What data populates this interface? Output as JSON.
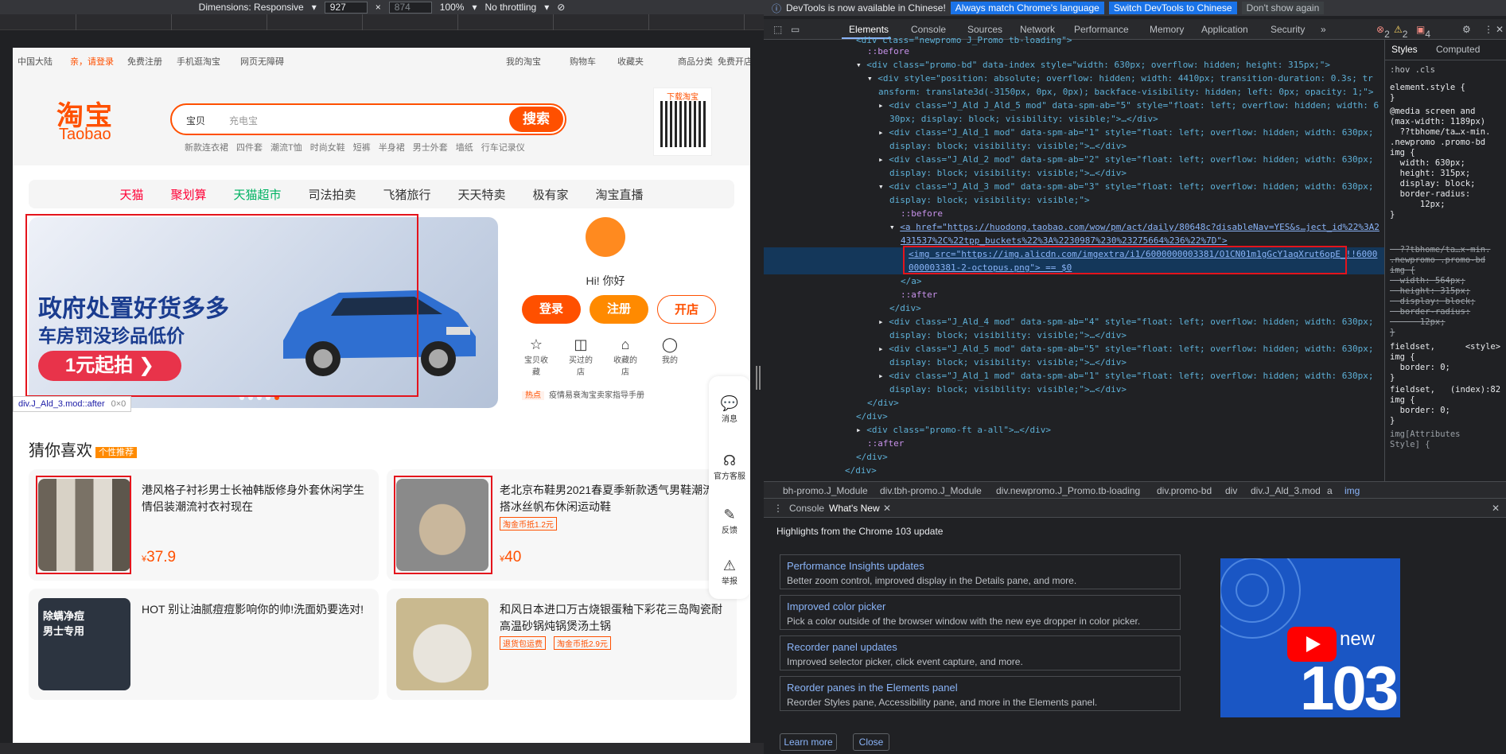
{
  "device_toolbar": {
    "dimensions_label": "Dimensions: Responsive",
    "width": "927",
    "height": "874",
    "zoom": "100%",
    "throttling": "No throttling"
  },
  "taobao": {
    "topbar": [
      "中国大陆",
      "亲，请登录",
      "免费注册",
      "手机逛淘宝",
      "网页无障碍",
      "我的淘宝",
      "购物车",
      "收藏夹",
      "商品分类",
      "免费开店"
    ],
    "logo_cn": "淘宝",
    "logo_en": "Taobao",
    "search_category": "宝贝",
    "search_placeholder": "充电宝",
    "search_button": "搜索",
    "hot_words": [
      "新款连衣裙",
      "四件套",
      "潮流T恤",
      "时尚女鞋",
      "短裤",
      "半身裙",
      "男士外套",
      "墙纸",
      "行车记录仪"
    ],
    "qr_title": "下载淘宝",
    "nav": [
      "天猫",
      "聚划算",
      "天猫超市",
      "司法拍卖",
      "飞猪旅行",
      "天天特卖",
      "极有家",
      "淘宝直播"
    ],
    "banner": {
      "line1": "政府处置好货多多",
      "line2": "车房罚没珍品低价",
      "cta": "1元起拍"
    },
    "inspect_tip": {
      "selector": "div.J_Ald_3.mod::after",
      "size": "0×0"
    },
    "user": {
      "greeting": "Hi! 你好",
      "login": "登录",
      "register": "注册",
      "open_shop": "开店",
      "icons": [
        "宝贝收藏",
        "买过的店",
        "收藏的店",
        "我的"
      ],
      "notice_tag": "热点",
      "notice_text": "疫情易衰淘宝卖家指导手册"
    },
    "float_bar": [
      "消息",
      "官方客服",
      "反馈",
      "举报"
    ],
    "guess_title": "猜你喜欢",
    "guess_badge": "个性推荐",
    "products": [
      {
        "title": "港风格子衬衫男士长袖韩版修身外套休闲学生情侣装潮流衬衣衬现在",
        "tag": "",
        "price": "37.9"
      },
      {
        "title": "老北京布鞋男2021春夏季新款透气男鞋潮流百搭冰丝帆布休闲运动鞋",
        "tag": "淘金币抵1.2元",
        "price": "40"
      },
      {
        "title": "HOT 别让油腻痘痘影响你的帅!洗面奶要选对!",
        "tag": "",
        "price": ""
      },
      {
        "title": "和风日本进口万古烧银蛋釉下彩花三岛陶瓷耐高温砂锅炖锅煲汤土锅",
        "tag": "退货包运费",
        "tag2": "淘金币抵2.9元",
        "price": ""
      }
    ],
    "product_overlay_text": "除螨净痘 男士专用",
    "currency": "¥"
  },
  "devtools": {
    "info_text": "DevTools is now available in Chinese!",
    "info_btn1": "Always match Chrome's language",
    "info_btn2": "Switch DevTools to Chinese",
    "info_btn3": "Don't show again",
    "tabs": [
      "Elements",
      "Console",
      "Sources",
      "Network",
      "Performance",
      "Memory",
      "Application",
      "Security"
    ],
    "issues": {
      "errors": "2",
      "warnings": "2",
      "issues": "4"
    },
    "dom_lines": [
      "<div class=\"newpromo J_Promo tb-loading\">",
      "::before",
      "<div class=\"promo-bd\" data-index style=\"width: 630px; overflow: hidden; height: 315px;\">",
      "<div style=\"position: absolute; overflow: hidden; width: 4410px; transition-duration: 0.3s; tr",
      "ansform: translate3d(-3150px, 0px, 0px); backface-visibility: hidden; left: 0px; opacity: 1;\">",
      "<div class=\"J_Ald J_Ald_5 mod\" data-spm-ab=\"5\" style=\"float: left; overflow: hidden; width: 6",
      "30px; display: block; visibility: visible;\">…</div>",
      "<div class=\"J_Ald_1 mod\" data-spm-ab=\"1\" style=\"float: left; overflow: hidden; width: 630px;",
      "display: block; visibility: visible;\">…</div>",
      "<div class=\"J_Ald_2 mod\" data-spm-ab=\"2\" style=\"float: left; overflow: hidden; width: 630px;",
      "display: block; visibility: visible;\">…</div>",
      "<div class=\"J_Ald_3 mod\" data-spm-ab=\"3\" style=\"float: left; overflow: hidden; width: 630px;",
      "display: block; visibility: visible;\">",
      "::before",
      "<a href=\"https://huodong.taobao.com/wow/pm/act/daily/80648c?disableNav=YES&s…ject_id%22%3A2",
      "431537%2C%22tpp_buckets%22%3A%2230987%230%23275664%236%22%7D\">",
      "<img src=\"https://img.alicdn.com/imgextra/i1/6000000003381/O1CN01m1gGcY1aqXrut6opE_!!6000",
      "000003381-2-octopus.png\"> == $0",
      "</a>",
      "::after",
      "</div>",
      "<div class=\"J_Ald_4 mod\" data-spm-ab=\"4\" style=\"float: left; overflow: hidden; width: 630px;",
      "display: block; visibility: visible;\">…</div>",
      "<div class=\"J_Ald_5 mod\" data-spm-ab=\"5\" style=\"float: left; overflow: hidden; width: 630px;",
      "display: block; visibility: visible;\">…</div>",
      "<div class=\"J_Ald_1 mod\" data-spm-ab=\"1\" style=\"float: left; overflow: hidden; width: 630px;",
      "display: block; visibility: visible;\">…</div>",
      "</div>",
      "</div>",
      "<div class=\"promo-ft a-all\">…</div>",
      "::after",
      "</div>",
      "</div>"
    ],
    "breadcrumbs": [
      "bh-promo.J_Module",
      "div.tbh-promo.J_Module",
      "div.newpromo.J_Promo.tb-loading",
      "div.promo-bd",
      "div",
      "div.J_Ald_3.mod",
      "a",
      "img"
    ],
    "styles_tabs": [
      "Styles",
      "Computed"
    ],
    "styles_filter": ":hov .cls",
    "styles_blocks": [
      "element.style {\n}",
      "@media screen and\n(max-width: 1189px)\n  ??tbhome/ta…x-min.\n.newpromo .promo-bd\nimg {\n  width: 630px;\n  height: 315px;\n  display: block;\n  border-radius:\n      12px;\n}",
      "  ??tbhome/ta…x-min.\n.newpromo .promo-bd\nimg {\n  width: 564px;\n  height: 315px;\n  display: block;\n  border-radius:\n      12px;\n}",
      "fieldset,      <style>\nimg {\n  border: 0;\n}",
      "fieldset,   (index):82\nimg {\n  border: 0;\n}",
      "img[Attributes\nStyle] {"
    ],
    "drawer_tabs": [
      "Console",
      "What's New"
    ],
    "whats_new_heading": "Highlights from the Chrome 103 update",
    "features": [
      {
        "title": "Performance Insights updates",
        "desc": "Better zoom control, improved display in the Details pane, and more."
      },
      {
        "title": "Improved color picker",
        "desc": "Pick a color outside of the browser window with the new eye dropper in color picker."
      },
      {
        "title": "Recorder panel updates",
        "desc": "Improved selector picker, click event capture, and more."
      },
      {
        "title": "Reorder panes in the Elements panel",
        "desc": "Reorder Styles pane, Accessibility pane, and more in the Elements panel."
      }
    ],
    "promo_new": "new",
    "promo_num": "103",
    "learn_more": "Learn more",
    "close": "Close"
  },
  "colors": {
    "taobao_orange": "#ff5000",
    "highlight_red": "#e4141c",
    "devtools_bg": "#202124",
    "link_blue": "#8ab4f8"
  }
}
